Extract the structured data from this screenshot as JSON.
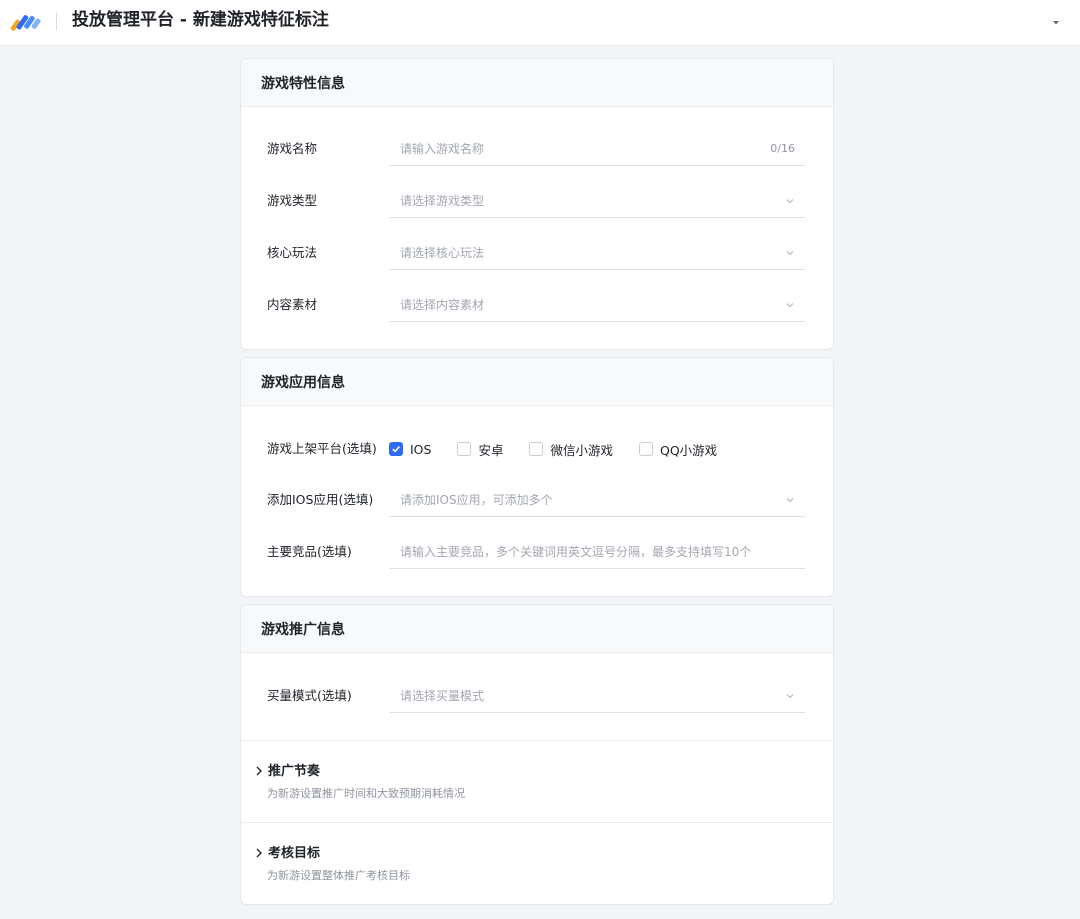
{
  "header": {
    "title": "投放管理平台 - 新建游戏特征标注",
    "logo_icon": "brand-logo-icon",
    "menu_icon": "caret-down-icon"
  },
  "colors": {
    "accent": "#2e6cf6",
    "page_bg": "#f2f4f7",
    "card_head_bg": "#f8f9fb"
  },
  "sections": {
    "features": {
      "title": "游戏特性信息",
      "name": {
        "label": "游戏名称",
        "placeholder": "请输入游戏名称",
        "counter": "0/16"
      },
      "type": {
        "label": "游戏类型",
        "placeholder": "请选择游戏类型"
      },
      "core": {
        "label": "核心玩法",
        "placeholder": "请选择核心玩法"
      },
      "content": {
        "label": "内容素材",
        "placeholder": "请选择内容素材"
      }
    },
    "app": {
      "title": "游戏应用信息",
      "platforms": {
        "label": "游戏上架平台(选填)",
        "options": [
          {
            "label": "IOS",
            "checked": true
          },
          {
            "label": "安卓",
            "checked": false
          },
          {
            "label": "微信小游戏",
            "checked": false
          },
          {
            "label": "QQ小游戏",
            "checked": false
          }
        ]
      },
      "ios_app": {
        "label": "添加IOS应用(选填)",
        "placeholder": "请添加IOS应用，可添加多个"
      },
      "competitors": {
        "label": "主要竞品(选填)",
        "placeholder": "请输入主要竞品，多个关键词用英文逗号分隔，最多支持填写10个"
      }
    },
    "promo": {
      "title": "游戏推广信息",
      "buy_mode": {
        "label": "买量模式(选填)",
        "placeholder": "请选择买量模式"
      },
      "rhythm": {
        "title": "推广节奏",
        "desc": "为新游设置推广时间和大致预期消耗情况"
      },
      "target": {
        "title": "考核目标",
        "desc": "为新游设置整体推广考核目标"
      }
    }
  }
}
